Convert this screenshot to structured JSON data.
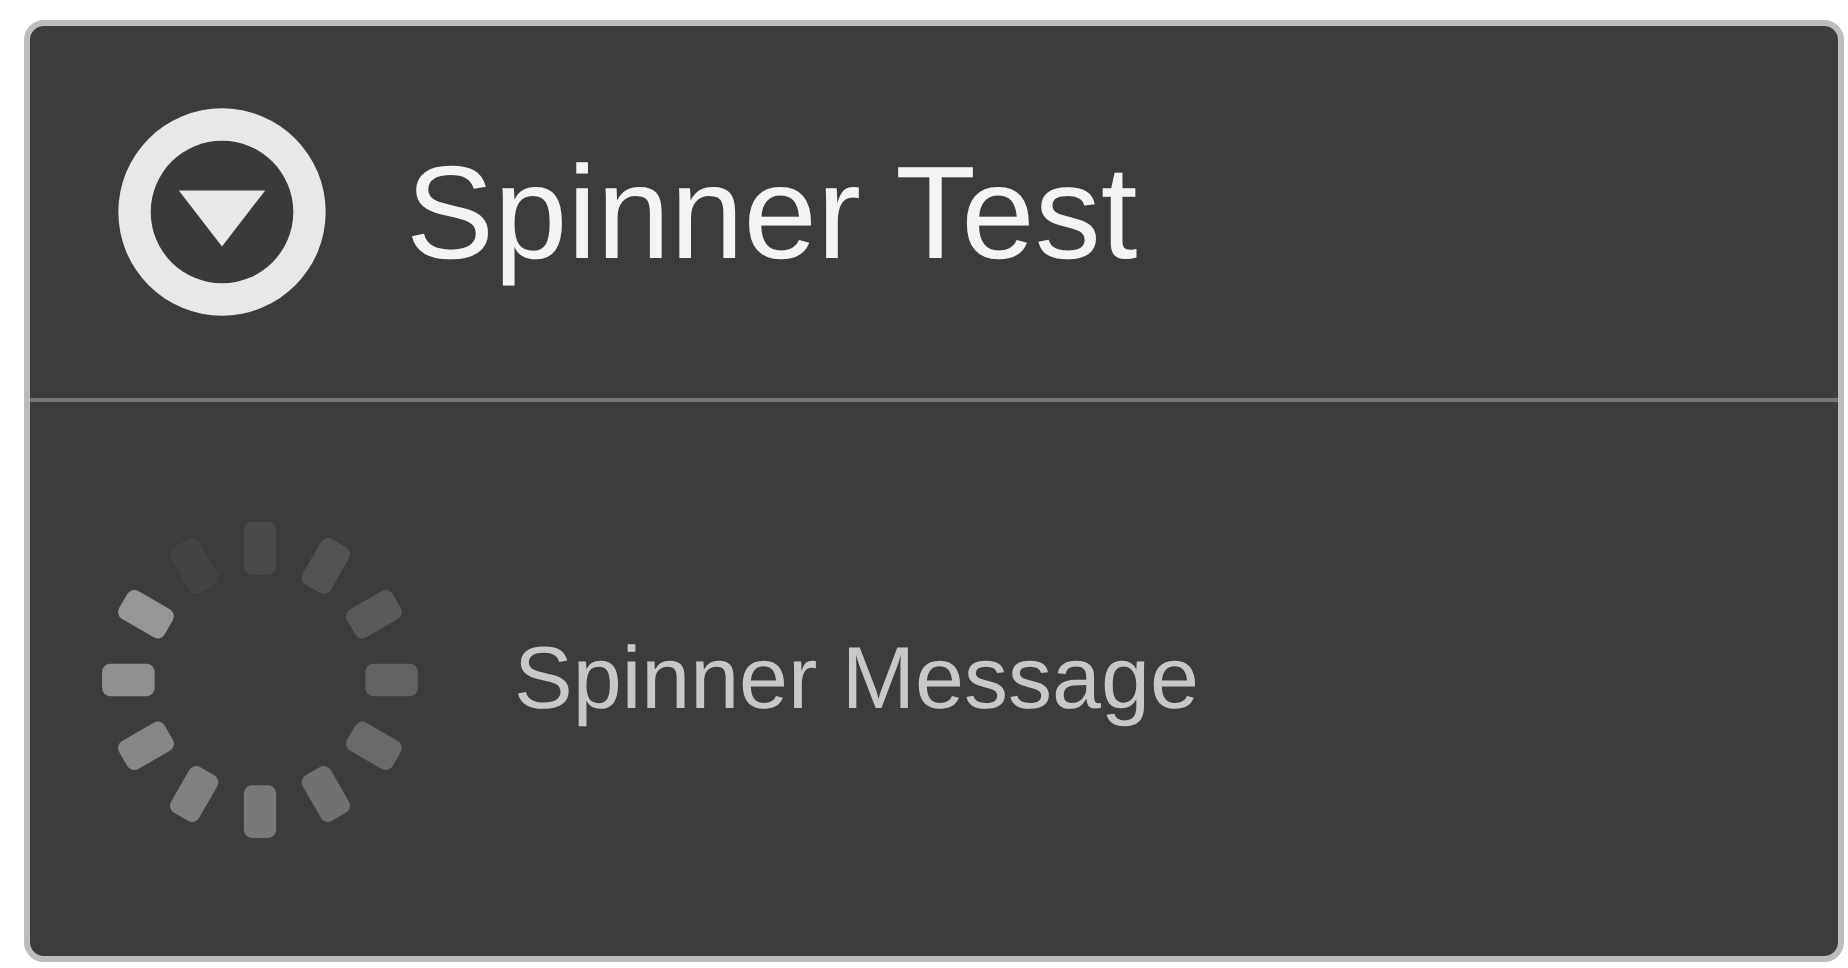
{
  "dialog": {
    "title": "Spinner Test",
    "message": "Spinner Message"
  }
}
